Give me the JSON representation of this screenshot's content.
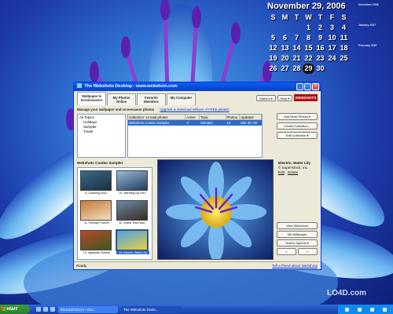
{
  "calendar": {
    "title": "November 29, 2006",
    "day_headers": [
      "S",
      "M",
      "T",
      "W",
      "T",
      "F",
      "S"
    ],
    "days": [
      "",
      "",
      "",
      "1",
      "2",
      "3",
      "4",
      "5",
      "6",
      "7",
      "8",
      "9",
      "10",
      "11",
      "12",
      "13",
      "14",
      "15",
      "16",
      "17",
      "18",
      "19",
      "20",
      "21",
      "22",
      "23",
      "24",
      "25",
      "26",
      "27",
      "28",
      "29",
      "30",
      "",
      ""
    ],
    "today": "29",
    "mini_titles": [
      "December 2006",
      "January 2007",
      "February 2007"
    ]
  },
  "window": {
    "title": "The Webshots Desktop - www.webshots.com",
    "tabs": [
      "Wallpaper & Screensavers",
      "My Photos Online",
      "Favorite Members",
      "My Computer"
    ],
    "options_btn": "Options ▾",
    "help_btn": "Help ▾",
    "logo": "WEBSHOTS",
    "manage_text": "Manage your wallpaper and screensaver photos",
    "manage_link": "Upgrade & download millions of FREE photos!",
    "topics": [
      "All Topics",
      "Holidays",
      "Sampler",
      "Travel"
    ],
    "collection_headers": [
      "Collection: 14 total photos",
      "Active",
      "Topic",
      "Photos",
      "Updated"
    ],
    "collection_row": [
      "Webshots Combo Sampler",
      "✔",
      "Sampler",
      "14",
      "Mar 08, 06"
    ],
    "side_buttons": [
      "Add More Photos ▾",
      "Create Collection...",
      "Edit Collection ▾"
    ],
    "sampler_title": "Webshots Combo Sampler",
    "thumbs": [
      {
        "caption": "6. Crashing Door..",
        "color1": "#3a6a8a",
        "color2": "#1b2f40"
      },
      {
        "caption": "10. Warming Up Kart..",
        "color1": "#9ab8d8",
        "color2": "#223c60"
      },
      {
        "caption": "11. Friendly Forever",
        "color1": "#c87838",
        "color2": "#f0e0c0"
      },
      {
        "caption": "12. Grand Teton and ..",
        "color1": "#6a88a8",
        "color2": "#3a2e22"
      },
      {
        "caption": "13. Japanese Garden",
        "color1": "#b84828",
        "color2": "#3a5a22"
      },
      {
        "caption": "14. Electric, Water Lily",
        "color1": "#4aa0e8",
        "color2": "#e8d040"
      }
    ],
    "photo_name": "Electric, Water Lily",
    "photo_credit": "© SuperStock, Inc.",
    "edit_link": "Edit",
    "delete_link": "Delete",
    "view_buttons": [
      "View Slideshow",
      "Set Wallpaper",
      "Online Options ▾"
    ],
    "prev": "«",
    "next": "»",
    "status": "Ready",
    "tell_friend": "Tell a friend about Webshots"
  },
  "taskbar": {
    "start": "start",
    "tasks": [
      "Microsoft Excel - Gra...",
      "The Webshots Deskt..."
    ]
  },
  "watermark": "LO4D.com"
}
